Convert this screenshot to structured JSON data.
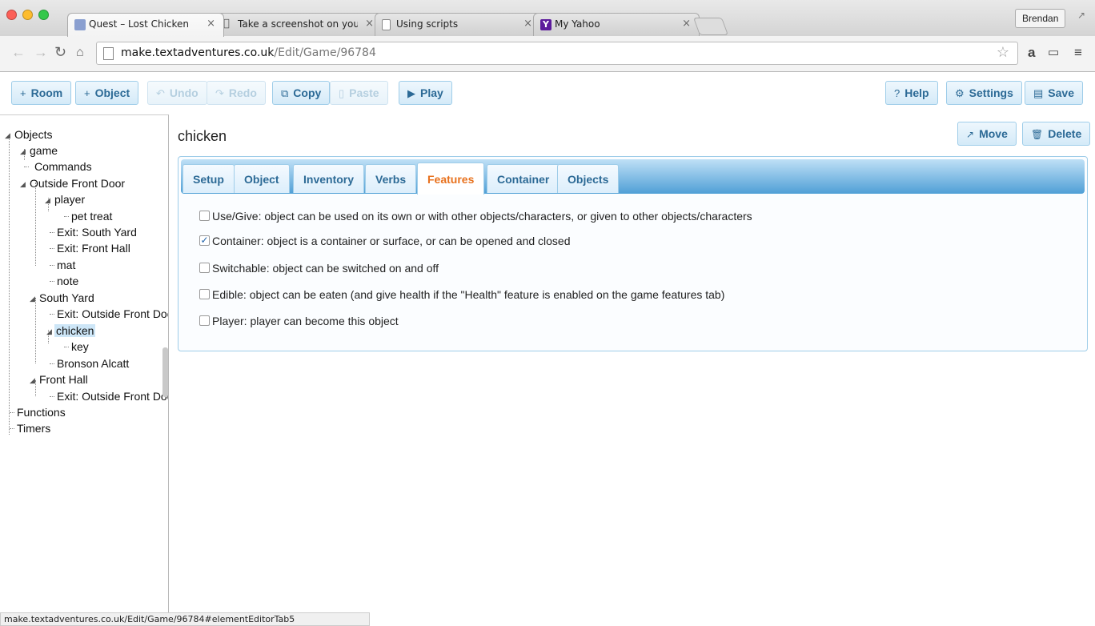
{
  "browser": {
    "tabs": [
      {
        "title": "Quest – Lost Chicken",
        "icon": "quest-favicon",
        "active": true
      },
      {
        "title": "Take a screenshot on your",
        "icon": "apple-favicon",
        "active": false
      },
      {
        "title": "Using scripts",
        "icon": "page-favicon",
        "active": false
      },
      {
        "title": "My Yahoo",
        "icon": "yahoo-favicon",
        "active": false
      }
    ],
    "close_glyph": "×",
    "profile": "Brendan",
    "url_host": "make.textadventures.co.uk",
    "url_path": "/Edit/Game/96784",
    "status_url": "make.textadventures.co.uk/Edit/Game/96784#elementEditorTab5"
  },
  "toolbar": {
    "room": "Room",
    "object": "Object",
    "undo": "Undo",
    "redo": "Redo",
    "copy": "Copy",
    "paste": "Paste",
    "play": "Play",
    "help": "Help",
    "settings": "Settings",
    "save": "Save"
  },
  "tree": {
    "objects": "Objects",
    "game": "game",
    "commands": "Commands",
    "outside_front_door": "Outside Front Door",
    "player": "player",
    "pet_treat": "pet treat",
    "exit_south_yard": "Exit: South Yard",
    "exit_front_hall": "Exit: Front Hall",
    "mat": "mat",
    "note": "note",
    "south_yard": "South Yard",
    "exit_outside_front_door_1": "Exit: Outside Front Doo",
    "chicken": "chicken",
    "key": "key",
    "bronson": "Bronson Alcatt",
    "front_hall": "Front Hall",
    "exit_outside_front_door_2": "Exit: Outside Front Doo",
    "functions": "Functions",
    "timers": "Timers"
  },
  "main": {
    "title": "chicken",
    "move": "Move",
    "delete": "Delete",
    "tabs": [
      "Setup",
      "Object",
      "Inventory",
      "Verbs",
      "Features",
      "Container",
      "Objects"
    ],
    "active_tab": "Features",
    "features": [
      {
        "label": "Use/Give: object can be used on its own or with other objects/characters, or given to other objects/characters",
        "checked": false
      },
      {
        "label": "Container: object is a container or surface, or can be opened and closed",
        "checked": true
      },
      {
        "label": "Switchable: object can be switched on and off",
        "checked": false
      },
      {
        "label": "Edible: object can be eaten (and give health if the \"Health\" feature is enabled on the game features tab)",
        "checked": false
      },
      {
        "label": "Player: player can become this object",
        "checked": false
      }
    ]
  },
  "colors": {
    "accent": "#2c6a96",
    "active_tab": "#e8711d",
    "selection": "#cde6f7"
  }
}
